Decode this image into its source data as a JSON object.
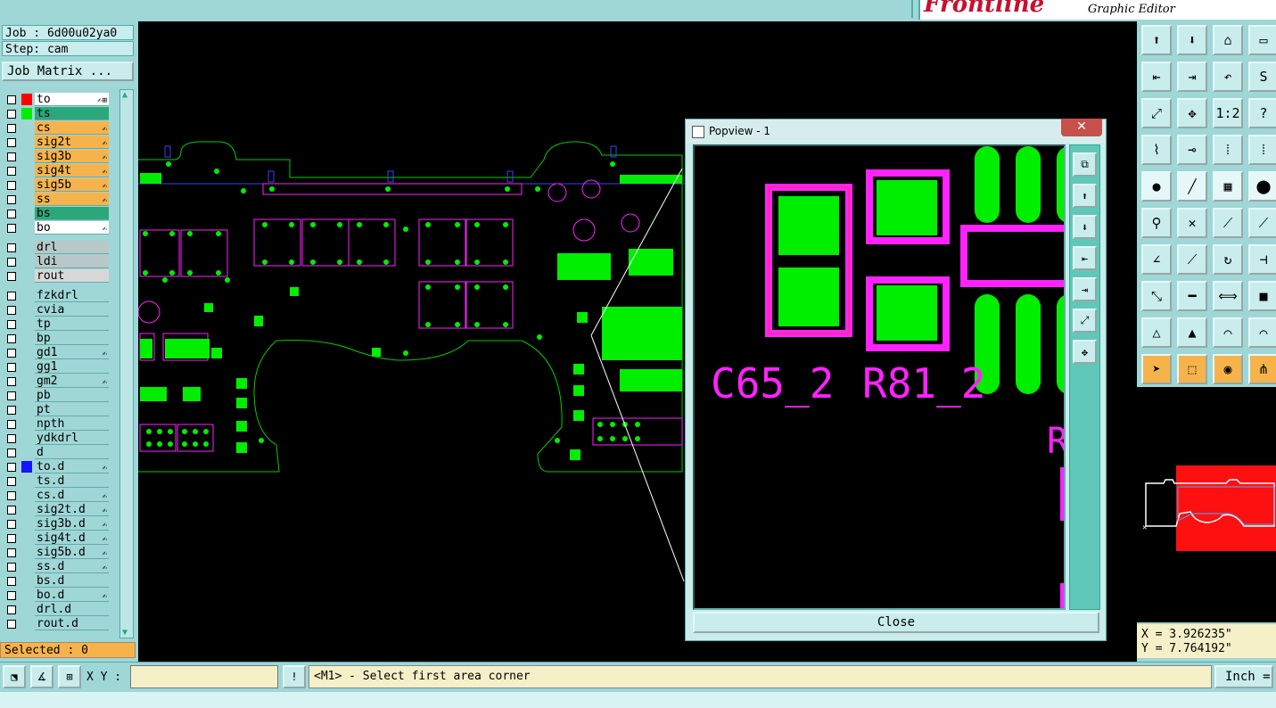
{
  "brand": {
    "logo": "Frontline",
    "subtitle": "Graphic Editor"
  },
  "left_panel": {
    "job": "Job : 6d00u02ya0",
    "step": "Step: cam",
    "job_matrix_label": "Job Matrix ...",
    "selected": "Selected : 0",
    "groups": [
      [
        {
          "name": "to",
          "bg": "#ffffff",
          "swatch": "#ff0000",
          "mark": "✍⊞"
        },
        {
          "name": "ts",
          "bg": "#2aa87c",
          "swatch": "#00ee00",
          "mark": ""
        },
        {
          "name": "cs",
          "bg": "#f6b34c",
          "swatch": "",
          "mark": "✍"
        },
        {
          "name": "sig2t",
          "bg": "#f6b34c",
          "swatch": "",
          "mark": "✍"
        },
        {
          "name": "sig3b",
          "bg": "#f6b34c",
          "swatch": "",
          "mark": "✍"
        },
        {
          "name": "sig4t",
          "bg": "#f6b34c",
          "swatch": "",
          "mark": "✍"
        },
        {
          "name": "sig5b",
          "bg": "#f6b34c",
          "swatch": "",
          "mark": "✍"
        },
        {
          "name": "ss",
          "bg": "#f6b34c",
          "swatch": "",
          "mark": "✍"
        },
        {
          "name": "bs",
          "bg": "#2aa87c",
          "swatch": "",
          "mark": ""
        },
        {
          "name": "bo",
          "bg": "#ffffff",
          "swatch": "",
          "mark": "✍"
        }
      ],
      [
        {
          "name": "drl",
          "bg": "#b8c8c8",
          "swatch": "",
          "mark": ""
        },
        {
          "name": "ldi",
          "bg": "#b8c8c8",
          "swatch": "",
          "mark": ""
        },
        {
          "name": "rout",
          "bg": "#d8d8d8",
          "swatch": "",
          "mark": ""
        }
      ],
      [
        {
          "name": "fzkdrl",
          "bg": "#9fd6d6",
          "swatch": "",
          "mark": ""
        },
        {
          "name": "cvia",
          "bg": "#9fd6d6",
          "swatch": "",
          "mark": ""
        },
        {
          "name": "tp",
          "bg": "#9fd6d6",
          "swatch": "",
          "mark": ""
        },
        {
          "name": "bp",
          "bg": "#9fd6d6",
          "swatch": "",
          "mark": ""
        },
        {
          "name": "gd1",
          "bg": "#9fd6d6",
          "swatch": "",
          "mark": "✍"
        },
        {
          "name": "gg1",
          "bg": "#9fd6d6",
          "swatch": "",
          "mark": ""
        },
        {
          "name": "gm2",
          "bg": "#9fd6d6",
          "swatch": "",
          "mark": "✍"
        },
        {
          "name": "pb",
          "bg": "#9fd6d6",
          "swatch": "",
          "mark": ""
        },
        {
          "name": "pt",
          "bg": "#9fd6d6",
          "swatch": "",
          "mark": ""
        },
        {
          "name": "npth",
          "bg": "#9fd6d6",
          "swatch": "",
          "mark": ""
        },
        {
          "name": "ydkdrl",
          "bg": "#9fd6d6",
          "swatch": "",
          "mark": ""
        },
        {
          "name": "d",
          "bg": "#9fd6d6",
          "swatch": "",
          "mark": ""
        },
        {
          "name": "to.d",
          "bg": "#9fd6d6",
          "swatch": "#1515ff",
          "mark": "✍"
        },
        {
          "name": "ts.d",
          "bg": "#9fd6d6",
          "swatch": "",
          "mark": ""
        },
        {
          "name": "cs.d",
          "bg": "#9fd6d6",
          "swatch": "",
          "mark": "✍"
        },
        {
          "name": "sig2t.d",
          "bg": "#9fd6d6",
          "swatch": "",
          "mark": "✍"
        },
        {
          "name": "sig3b.d",
          "bg": "#9fd6d6",
          "swatch": "",
          "mark": "✍"
        },
        {
          "name": "sig4t.d",
          "bg": "#9fd6d6",
          "swatch": "",
          "mark": "✍"
        },
        {
          "name": "sig5b.d",
          "bg": "#9fd6d6",
          "swatch": "",
          "mark": "✍"
        },
        {
          "name": "ss.d",
          "bg": "#9fd6d6",
          "swatch": "",
          "mark": "✍"
        },
        {
          "name": "bs.d",
          "bg": "#9fd6d6",
          "swatch": "",
          "mark": ""
        },
        {
          "name": "bo.d",
          "bg": "#9fd6d6",
          "swatch": "",
          "mark": "✍"
        },
        {
          "name": "drl.d",
          "bg": "#9fd6d6",
          "swatch": "",
          "mark": ""
        },
        {
          "name": "rout.d",
          "bg": "#9fd6d6",
          "swatch": "",
          "mark": ""
        }
      ]
    ]
  },
  "popview": {
    "title": "Popview - 1",
    "close_x": "✕",
    "close_label": "Close",
    "labels": {
      "c65": "C65_2",
      "r81": "R81_2",
      "r": "R"
    }
  },
  "right_panel": {
    "tools": [
      {
        "name": "layer-up-icon",
        "glyph": "⬆",
        "style": ""
      },
      {
        "name": "layer-down-icon",
        "glyph": "⬇",
        "style": ""
      },
      {
        "name": "home-icon",
        "glyph": "⌂",
        "style": ""
      },
      {
        "name": "window-icon",
        "glyph": "▭",
        "style": ""
      },
      {
        "name": "import-icon",
        "glyph": "⇤",
        "style": ""
      },
      {
        "name": "export-icon",
        "glyph": "⇥",
        "style": ""
      },
      {
        "name": "undo-icon",
        "glyph": "↶",
        "style": ""
      },
      {
        "name": "snake-icon",
        "glyph": "S",
        "style": ""
      },
      {
        "name": "fit-icon",
        "glyph": "⤢",
        "style": ""
      },
      {
        "name": "center-icon",
        "glyph": "✥",
        "style": ""
      },
      {
        "name": "scale-icon",
        "glyph": "1:2",
        "style": ""
      },
      {
        "name": "help-icon",
        "glyph": "?",
        "style": ""
      },
      {
        "name": "measure-icon",
        "glyph": "⌇",
        "style": ""
      },
      {
        "name": "snap-icon",
        "glyph": "⊸",
        "style": ""
      },
      {
        "name": "net-icon",
        "glyph": "⁞",
        "style": ""
      },
      {
        "name": "net-alt-icon",
        "glyph": "⁞",
        "style": ""
      },
      {
        "name": "pad-icon",
        "glyph": "●",
        "style": "dark"
      },
      {
        "name": "edit-line-icon",
        "glyph": "╱",
        "style": "dark"
      },
      {
        "name": "ruler-icon",
        "glyph": "▦",
        "style": "dark"
      },
      {
        "name": "dot-icon",
        "glyph": "⬤",
        "style": "dark"
      },
      {
        "name": "connect-icon",
        "glyph": "⚲",
        "style": ""
      },
      {
        "name": "cross-icon",
        "glyph": "✕",
        "style": ""
      },
      {
        "name": "line-add-icon",
        "glyph": "⟋",
        "style": ""
      },
      {
        "name": "line-add-alt-icon",
        "glyph": "⟋",
        "style": ""
      },
      {
        "name": "angle-icon",
        "glyph": "∠",
        "style": ""
      },
      {
        "name": "slope-icon",
        "glyph": "⟋",
        "style": ""
      },
      {
        "name": "arc-icon",
        "glyph": "↻",
        "style": ""
      },
      {
        "name": "fuse-icon",
        "glyph": "⊣",
        "style": ""
      },
      {
        "name": "move-icon",
        "glyph": "⤡",
        "style": ""
      },
      {
        "name": "minus-icon",
        "glyph": "━",
        "style": ""
      },
      {
        "name": "resize-icon",
        "glyph": "⟺",
        "style": ""
      },
      {
        "name": "shape-icon",
        "glyph": "■",
        "style": ""
      },
      {
        "name": "triangle-icon",
        "glyph": "△",
        "style": ""
      },
      {
        "name": "triangle-up-icon",
        "glyph": "▲",
        "style": ""
      },
      {
        "name": "arch-icon",
        "glyph": "⌒",
        "style": ""
      },
      {
        "name": "arch-alt-icon",
        "glyph": "⌒",
        "style": ""
      },
      {
        "name": "select-arrow-icon",
        "glyph": "➤",
        "style": "orange"
      },
      {
        "name": "select-box-icon",
        "glyph": "⬚",
        "style": "orange"
      },
      {
        "name": "select-circle-icon",
        "glyph": "◉",
        "style": "orange"
      },
      {
        "name": "select-net-icon",
        "glyph": "⋔",
        "style": "orange"
      }
    ],
    "x_coord": "X = 3.926235\"",
    "y_coord": "Y = 7.764192\""
  },
  "bottom_bar": {
    "xy_label": "X Y :",
    "xy_value": "",
    "alert_glyph": "!",
    "prompt": "<M1> - Select first area corner",
    "unit": "Inch ="
  },
  "colors": {
    "panel": "#9fd6d6",
    "pad_green": "#00ee00",
    "silk_magenta": "#ff22ff",
    "outline_green": "#00cc00"
  }
}
